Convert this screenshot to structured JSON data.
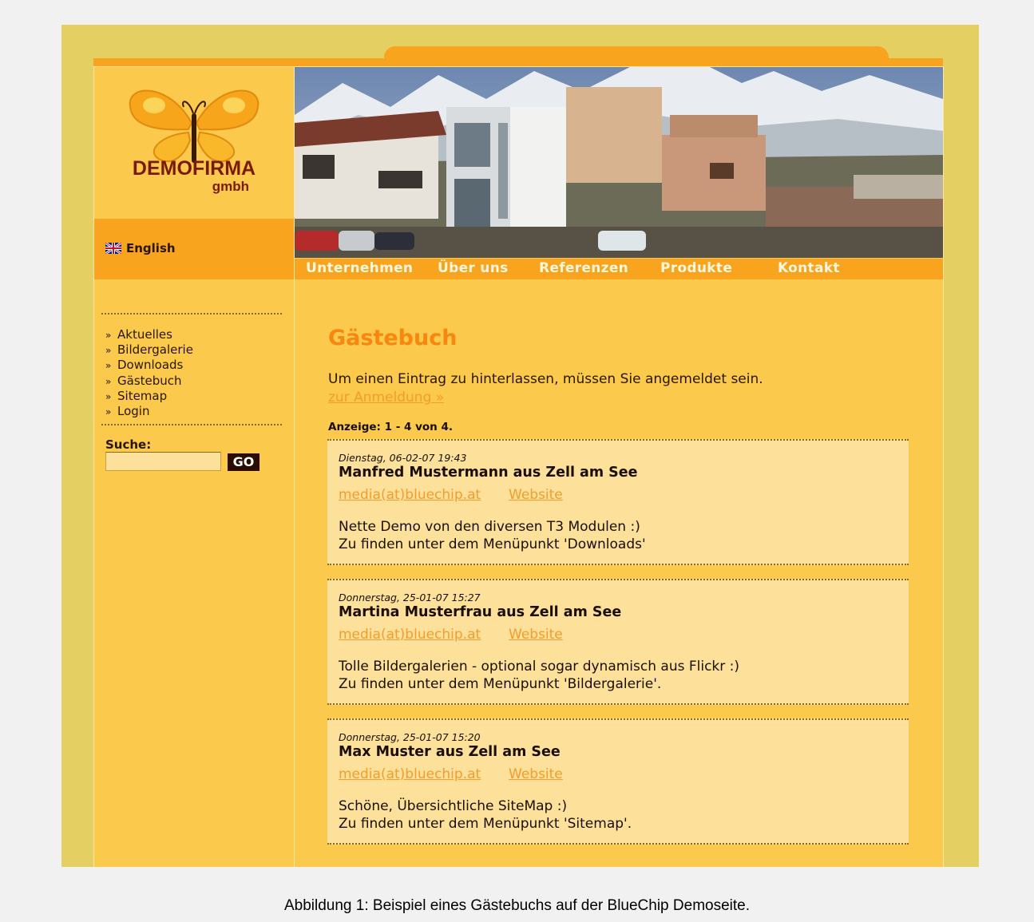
{
  "brand": {
    "name": "DEMOFIRMA",
    "sub": "gmbh"
  },
  "language": {
    "label": "English"
  },
  "nav": [
    "Unternehmen",
    "Über uns",
    "Referenzen",
    "Produkte",
    "Kontakt"
  ],
  "sidebar": {
    "items": [
      "Aktuelles",
      "Bildergalerie",
      "Downloads",
      "Gästebuch",
      "Sitemap",
      "Login"
    ],
    "search_label": "Suche:",
    "search_value": "",
    "go_label": "GO"
  },
  "main": {
    "title": "Gästebuch",
    "intro": "Um einen Eintrag zu hinterlassen, müssen Sie angemeldet sein.",
    "login_link": "zur Anmeldung »",
    "count": "Anzeige: 1 - 4 von 4.",
    "entries": [
      {
        "date": "Dienstag, 06-02-07 19:43",
        "name": "Manfred Mustermann aus Zell am See",
        "email": "media(at)bluechip.at",
        "website": "Website",
        "line1": "Nette Demo von den diversen T3 Modulen :)",
        "line2": "Zu finden unter dem Menüpunkt 'Downloads'"
      },
      {
        "date": "Donnerstag, 25-01-07 15:27",
        "name": "Martina Musterfrau aus Zell am See",
        "email": "media(at)bluechip.at",
        "website": "Website",
        "line1": "Tolle Bildergalerien - optional sogar dynamisch aus Flickr :)",
        "line2": "Zu finden unter dem Menüpunkt 'Bildergalerie'."
      },
      {
        "date": "Donnerstag, 25-01-07 15:20",
        "name": "Max Muster aus Zell am See",
        "email": "media(at)bluechip.at",
        "website": "Website",
        "line1": "Schöne, Übersichtliche SiteMap :)",
        "line2": "Zu finden unter dem Menüpunkt 'Sitemap'."
      }
    ]
  },
  "caption": "Abbildung 1: Beispiel eines Gästebuchs auf der BlueChip Demoseite.",
  "colors": {
    "accent": "#f9a41e",
    "panel": "#fbc94c",
    "entry": "#fde19a",
    "title": "#f8860f",
    "link": "#f49c2c"
  }
}
